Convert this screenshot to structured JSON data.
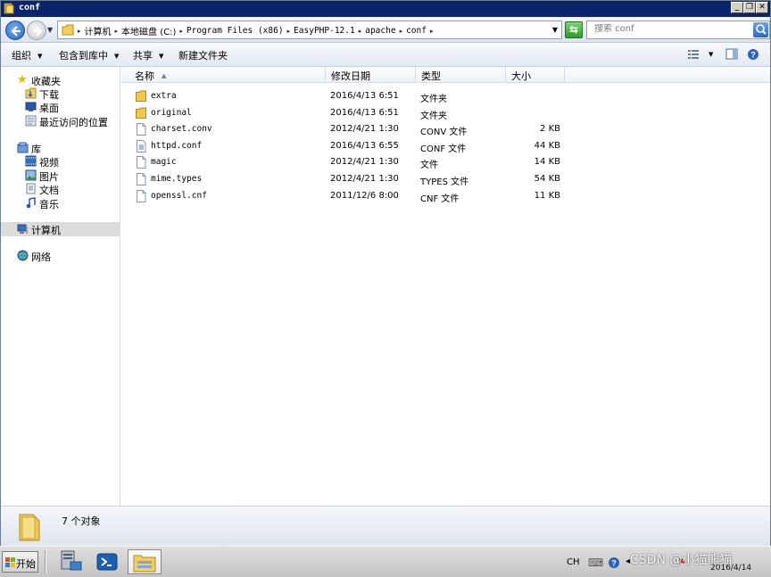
{
  "window": {
    "title": "conf",
    "controls": [
      "minimize-icon",
      "maximize-icon",
      "close-icon"
    ]
  },
  "address": {
    "crumbs": [
      {
        "label": "计算机",
        "mono": false
      },
      {
        "label": "本地磁盘 (C:)",
        "mono": false
      },
      {
        "label": "Program Files (x86)",
        "mono": true
      },
      {
        "label": "EasyPHP-12.1",
        "mono": true
      },
      {
        "label": "apache",
        "mono": true
      },
      {
        "label": "conf",
        "mono": true
      }
    ]
  },
  "search": {
    "placeholder": "搜索 conf"
  },
  "toolbar": {
    "organize": "组织",
    "include_library": "包含到库中",
    "share": "共享",
    "new_folder": "新建文件夹"
  },
  "sidebar": {
    "favorites": "收藏夹",
    "downloads": "下载",
    "desktop": "桌面",
    "recent": "最近访问的位置",
    "libraries": "库",
    "videos": "视频",
    "pictures": "图片",
    "documents": "文档",
    "music": "音乐",
    "computer": "计算机",
    "network": "网络"
  },
  "columns": {
    "name": "名称",
    "modified": "修改日期",
    "type": "类型",
    "size": "大小"
  },
  "files": [
    {
      "name": "extra",
      "modified": "2016/4/13 6:51",
      "type": "文件夹",
      "size": "",
      "icon": "folder-icon"
    },
    {
      "name": "original",
      "modified": "2016/4/13 6:51",
      "type": "文件夹",
      "size": "",
      "icon": "folder-icon"
    },
    {
      "name": "charset.conv",
      "modified": "2012/4/21 1:30",
      "type": "CONV 文件",
      "size": "2 KB",
      "icon": "file-icon"
    },
    {
      "name": "httpd.conf",
      "modified": "2016/4/13 6:55",
      "type": "CONF 文件",
      "size": "44 KB",
      "icon": "config-file-icon"
    },
    {
      "name": "magic",
      "modified": "2012/4/21 1:30",
      "type": "文件",
      "size": "14 KB",
      "icon": "file-icon"
    },
    {
      "name": "mime.types",
      "modified": "2012/4/21 1:30",
      "type": "TYPES 文件",
      "size": "54 KB",
      "icon": "file-icon"
    },
    {
      "name": "openssl.cnf",
      "modified": "2011/12/6 8:00",
      "type": "CNF 文件",
      "size": "11 KB",
      "icon": "file-icon"
    }
  ],
  "details": {
    "count": "7 个对象"
  },
  "taskbar": {
    "start": "开始",
    "lang": "CH",
    "clock": "2016/4/14",
    "watermark": "CSDN @小猫熊猫"
  }
}
